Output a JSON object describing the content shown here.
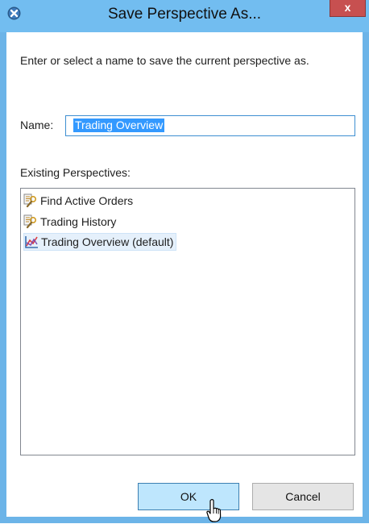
{
  "window": {
    "title": "Save Perspective As...",
    "close_glyph": "x"
  },
  "message": "Enter or select a name to save the current perspective as.",
  "name_field": {
    "label": "Name:",
    "value": "Trading Overview"
  },
  "existing": {
    "label": "Existing Perspectives:",
    "items": [
      {
        "label": "Find Active Orders",
        "icon": "search-perspective-icon",
        "selected": false
      },
      {
        "label": "Trading History",
        "icon": "search-perspective-icon",
        "selected": false
      },
      {
        "label": "Trading Overview (default)",
        "icon": "chart-perspective-icon",
        "selected": true
      }
    ]
  },
  "buttons": {
    "ok": "OK",
    "cancel": "Cancel"
  },
  "colors": {
    "title_bar": "#72bdf0",
    "close_button": "#c75050",
    "selection": "#3399ff",
    "ok_button": "#bee6fd"
  }
}
